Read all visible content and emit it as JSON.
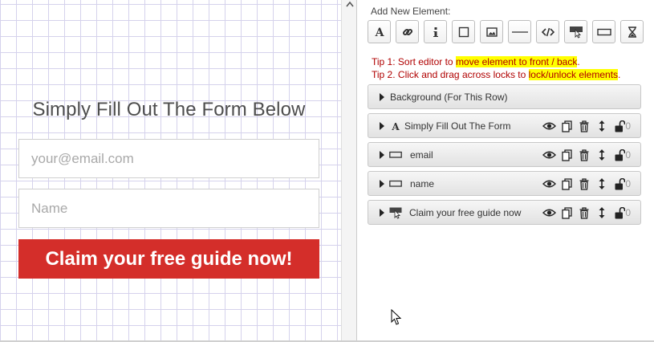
{
  "canvas": {
    "heading": "Simply Fill Out The Form Below",
    "email_placeholder": "your@email.com",
    "name_placeholder": "Name",
    "button_label": "Claim your free guide now!"
  },
  "panel": {
    "add_label": "Add New Element:",
    "tools": [
      {
        "name": "text-tool",
        "icon": "text-a-icon"
      },
      {
        "name": "link-tool",
        "icon": "link-icon"
      },
      {
        "name": "info-tool",
        "icon": "info-icon"
      },
      {
        "name": "box-tool",
        "icon": "square-icon"
      },
      {
        "name": "image-tool",
        "icon": "image-icon"
      },
      {
        "name": "divider-tool",
        "icon": "horizontal-line-icon"
      },
      {
        "name": "code-tool",
        "icon": "code-icon"
      },
      {
        "name": "button-tool",
        "icon": "button-click-icon"
      },
      {
        "name": "input-tool",
        "icon": "input-field-icon"
      },
      {
        "name": "timer-tool",
        "icon": "hourglass-icon"
      }
    ],
    "tip1_prefix": "Tip 1: Sort editor to ",
    "tip1_highlight": "move element to front / back",
    "tip1_suffix": ".",
    "tip2_prefix": "Tip 2. Click and drag across locks to ",
    "tip2_highlight": "lock/unlock elements",
    "tip2_suffix": ".",
    "rows": [
      {
        "label": "Background (For This Row)"
      },
      {
        "label": "Simply Fill Out The Form",
        "icon": "text-a-icon",
        "count": "0"
      },
      {
        "label": "email",
        "icon": "input-field-icon",
        "count": "0"
      },
      {
        "label": "name",
        "icon": "input-field-icon",
        "count": "0"
      },
      {
        "label": "Claim your free guide now",
        "icon": "button-click-icon",
        "count": "0"
      }
    ]
  },
  "colors": {
    "button_red": "#d42e2a",
    "tip_red": "#b00000",
    "highlight": "#ffff00",
    "grid_line": "#d5d2ec"
  }
}
